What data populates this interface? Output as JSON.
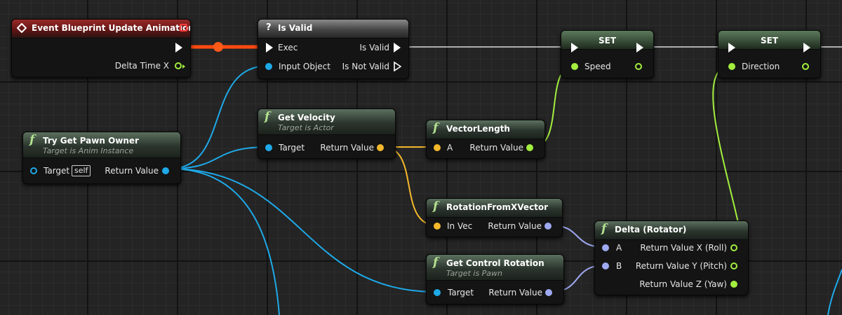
{
  "nodes": {
    "event_update": {
      "title": "Event Blueprint Update Animation",
      "delta_label": "Delta Time X"
    },
    "try_get_pawn": {
      "title": "Try Get Pawn Owner",
      "subtitle": "Target is Anim Instance",
      "target_label": "Target",
      "self_label": "self",
      "return_label": "Return Value"
    },
    "is_valid": {
      "title": "Is Valid",
      "exec_label": "Exec",
      "input_label": "Input Object",
      "valid_label": "Is Valid",
      "not_valid_label": "Is Not Valid"
    },
    "get_velocity": {
      "title": "Get Velocity",
      "subtitle": "Target is Actor",
      "target_label": "Target",
      "return_label": "Return Value"
    },
    "vector_length": {
      "title": "VectorLength",
      "a_label": "A",
      "return_label": "Return Value"
    },
    "rotation_from_x": {
      "title": "RotationFromXVector",
      "in_label": "In Vec",
      "return_label": "Return Value"
    },
    "get_control_rotation": {
      "title": "Get Control Rotation",
      "subtitle": "Target is Pawn",
      "target_label": "Target",
      "return_label": "Return Value"
    },
    "delta_rotator": {
      "title": "Delta (Rotator)",
      "a_label": "A",
      "b_label": "B",
      "rx_label": "Return Value X (Roll)",
      "ry_label": "Return Value Y (Pitch)",
      "rz_label": "Return Value Z (Yaw)"
    },
    "set_speed": {
      "title": "SET",
      "var_label": "Speed"
    },
    "set_direction": {
      "title": "SET",
      "var_label": "Direction"
    }
  },
  "icons": {
    "event": "event-diamond-icon",
    "function": "function-f-icon",
    "macro": "question-mark-icon"
  },
  "colors": {
    "exec": "#ffffff",
    "object": "#1ea9e8",
    "vector": "#f3b82b",
    "float": "#a3ee3f",
    "rotator": "#9ea9f2",
    "event_header": "#9a2a28",
    "pure_header": "#3e5240",
    "grid_background": "#242424"
  }
}
